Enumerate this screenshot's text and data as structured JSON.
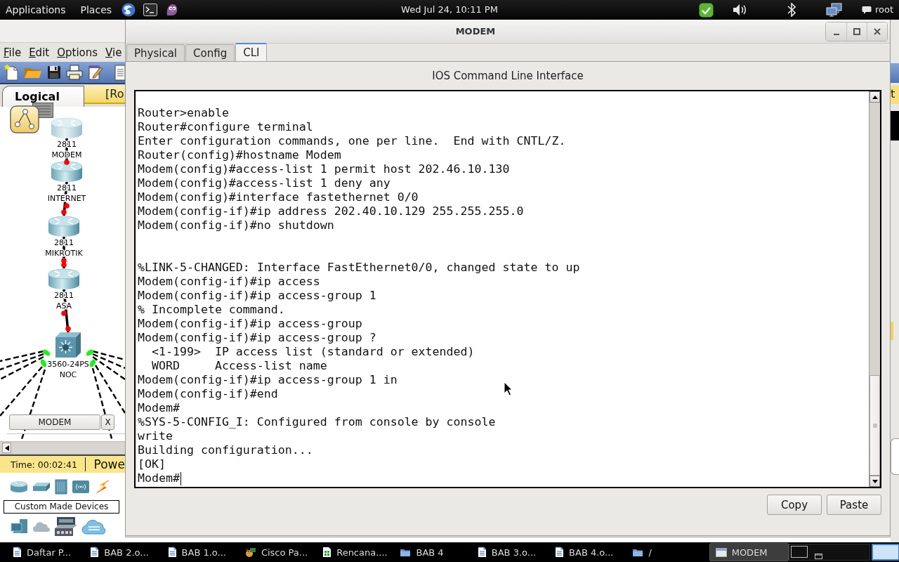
{
  "top_panel": {
    "menus": [
      "Applications",
      "Places"
    ],
    "clock": "Wed Jul 24, 10:11 PM",
    "user": "root"
  },
  "background_app": {
    "menus": [
      "File",
      "Edit",
      "Options",
      "Vie"
    ],
    "view_tab": "Logical",
    "view_bar_text": "[Ro",
    "devices": [
      {
        "kind": "router",
        "model": "2811",
        "name": "MODEM",
        "selected": true
      },
      {
        "kind": "router",
        "model": "2811",
        "name": "INTERNET",
        "selected": false
      },
      {
        "kind": "router",
        "model": "2811",
        "name": "MIKROTIK",
        "selected": false
      },
      {
        "kind": "router",
        "model": "2811",
        "name": "ASA",
        "selected": false
      },
      {
        "kind": "switch",
        "model": "3560-24PS",
        "name": "NOC",
        "selected": false
      }
    ],
    "links": [
      {
        "color": "#ff0000"
      },
      {
        "color": "#ff0000"
      },
      {
        "color": "#ff0000"
      },
      {
        "color": "#ff0000"
      }
    ],
    "access_links": [
      {
        "color": "#22ee22"
      },
      {
        "color": "#22ee22"
      },
      {
        "color": "#22ee22"
      },
      {
        "color": "#22ee22"
      }
    ],
    "open_device_button": "MODEM",
    "close_button": "X",
    "time": "Time: 00:02:41",
    "status_fragment": "Powe",
    "device_category": "Custom Made Devices",
    "edge_tab_fragment": "t"
  },
  "window": {
    "title": "MODEM",
    "tabs": [
      {
        "label": "Physical",
        "selected": false
      },
      {
        "label": "Config",
        "selected": false
      },
      {
        "label": "CLI",
        "selected": true
      }
    ],
    "heading": "IOS Command Line Interface",
    "terminal": {
      "lines": [
        {
          "kind": "blank"
        },
        {
          "kind": "line",
          "text": "Router>enable"
        },
        {
          "kind": "line",
          "text": "Router#configure terminal"
        },
        {
          "kind": "line",
          "text": "Enter configuration commands, one per line.  End with CNTL/Z."
        },
        {
          "kind": "line",
          "text": "Router(config)#hostname Modem"
        },
        {
          "kind": "line",
          "text": "Modem(config)#access-list 1 permit host 202.46.10.130"
        },
        {
          "kind": "line",
          "text": "Modem(config)#access-list 1 deny any"
        },
        {
          "kind": "line",
          "text": "Modem(config)#interface fastethernet 0/0"
        },
        {
          "kind": "line",
          "text": "Modem(config-if)#ip address 202.40.10.129 255.255.255.0"
        },
        {
          "kind": "line",
          "text": "Modem(config-if)#no shutdown"
        },
        {
          "kind": "blank"
        },
        {
          "kind": "blank"
        },
        {
          "kind": "line",
          "text": "%LINK-5-CHANGED: Interface FastEthernet0/0, changed state to up"
        },
        {
          "kind": "line",
          "text": "Modem(config-if)#ip access"
        },
        {
          "kind": "line",
          "text": "Modem(config-if)#ip access-group 1"
        },
        {
          "kind": "line",
          "text": "% Incomplete command."
        },
        {
          "kind": "line",
          "text": "Modem(config-if)#ip access-group"
        },
        {
          "kind": "line",
          "text": "Modem(config-if)#ip access-group ?"
        },
        {
          "kind": "line",
          "text": "  <1-199>  IP access list (standard or extended)"
        },
        {
          "kind": "line",
          "text": "  WORD     Access-list name"
        },
        {
          "kind": "line",
          "text": "Modem(config-if)#ip access-group 1 in"
        },
        {
          "kind": "line",
          "text": "Modem(config-if)#end"
        },
        {
          "kind": "line",
          "text": "Modem#"
        },
        {
          "kind": "line",
          "text": "%SYS-5-CONFIG_I: Configured from console by console"
        },
        {
          "kind": "line",
          "text": "write"
        },
        {
          "kind": "line",
          "text": "Building configuration..."
        },
        {
          "kind": "line",
          "text": "[OK]"
        },
        {
          "kind": "line",
          "text": "Modem#"
        }
      ],
      "cursor": true
    },
    "buttons": [
      "Copy",
      "Paste"
    ]
  },
  "taskbar": {
    "items": [
      {
        "kind": "document",
        "label": "Daftar P...",
        "selected": false
      },
      {
        "kind": "document",
        "label": "BAB 2.o...",
        "selected": false
      },
      {
        "kind": "document",
        "label": "BAB 1.o...",
        "selected": false
      },
      {
        "kind": "app",
        "label": "Cisco Pa...",
        "selected": false
      },
      {
        "kind": "spreadsheet",
        "label": "Rencana....",
        "selected": false
      },
      {
        "kind": "folder",
        "label": "BAB 4",
        "selected": false
      },
      {
        "kind": "document",
        "label": "BAB 3.o...",
        "selected": false
      },
      {
        "kind": "document",
        "label": "BAB 4.o...",
        "selected": false
      },
      {
        "kind": "folder",
        "label": "/",
        "selected": false
      },
      {
        "kind": "window",
        "label": "MODEM",
        "selected": true
      }
    ],
    "workspaces": [
      {
        "selected": false
      },
      {
        "selected": true
      }
    ]
  }
}
